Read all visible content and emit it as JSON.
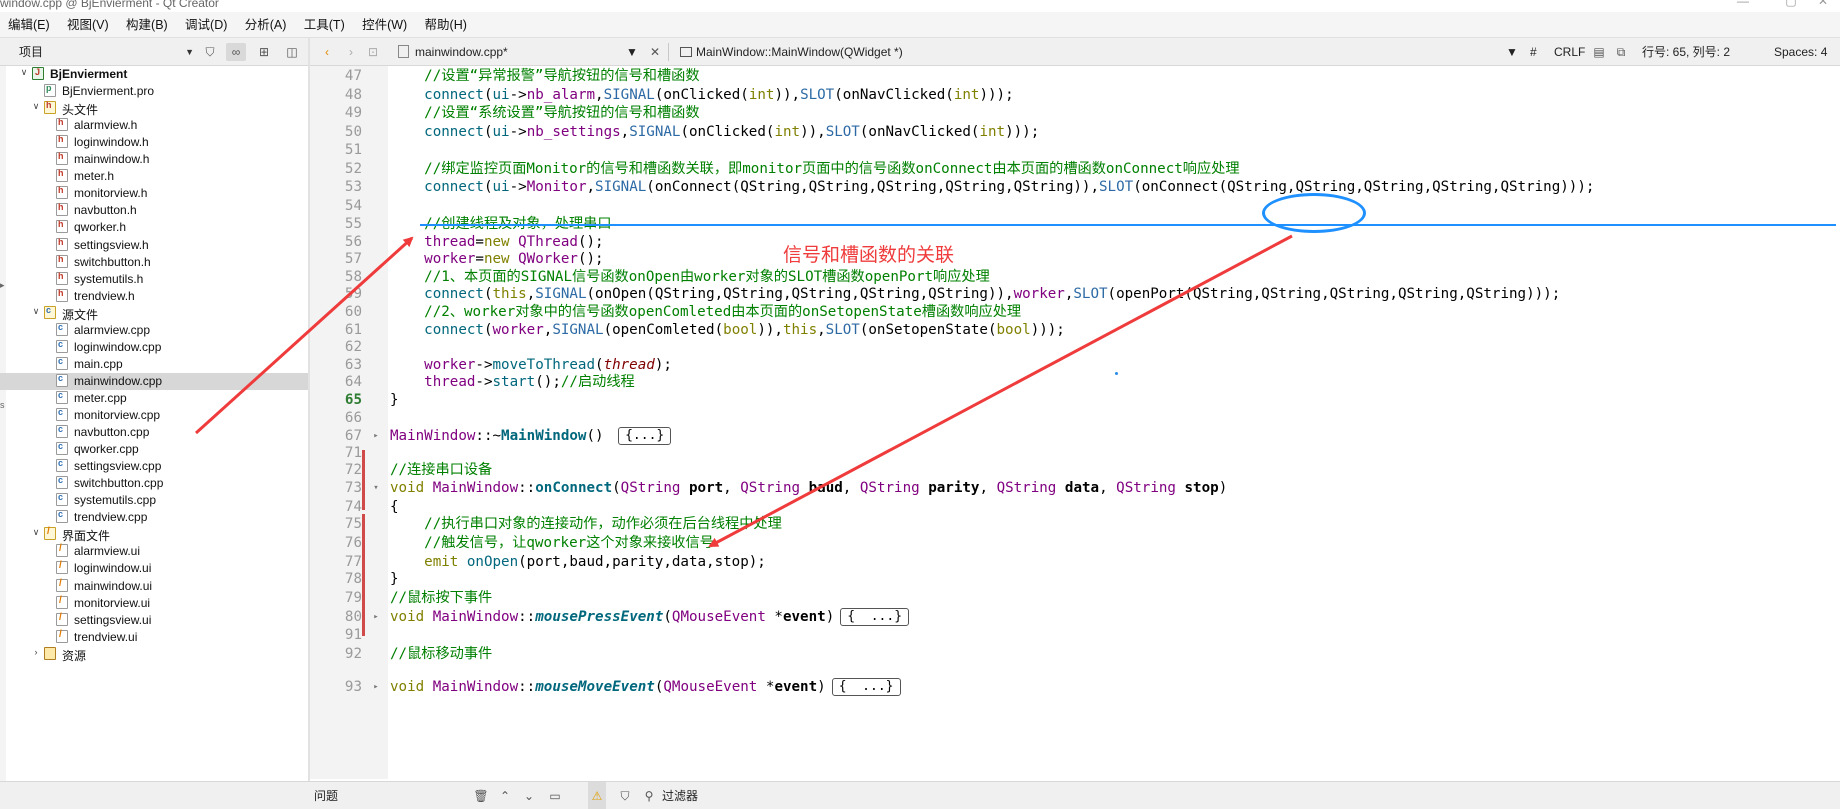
{
  "window": {
    "title": "window.cpp @ BjEnvierment - Qt Creator",
    "controls": [
      "—",
      "▢",
      "✕"
    ]
  },
  "menubar": [
    "编辑(E)",
    "视图(V)",
    "构建(B)",
    "调试(D)",
    "分析(A)",
    "工具(T)",
    "控件(W)",
    "帮助(H)"
  ],
  "left_panel": {
    "combo_label": "项目",
    "tree": [
      {
        "label": "BjEnvierment",
        "level": 0,
        "kind": "root",
        "expanded": true,
        "bold": true
      },
      {
        "label": "BjEnvierment.pro",
        "level": 1,
        "kind": "pro"
      },
      {
        "label": "头文件",
        "level": 1,
        "kind": "folder-h",
        "expanded": true
      },
      {
        "label": "alarmview.h",
        "level": 2,
        "kind": "h"
      },
      {
        "label": "loginwindow.h",
        "level": 2,
        "kind": "h"
      },
      {
        "label": "mainwindow.h",
        "level": 2,
        "kind": "h"
      },
      {
        "label": "meter.h",
        "level": 2,
        "kind": "h"
      },
      {
        "label": "monitorview.h",
        "level": 2,
        "kind": "h"
      },
      {
        "label": "navbutton.h",
        "level": 2,
        "kind": "h"
      },
      {
        "label": "qworker.h",
        "level": 2,
        "kind": "h"
      },
      {
        "label": "settingsview.h",
        "level": 2,
        "kind": "h"
      },
      {
        "label": "switchbutton.h",
        "level": 2,
        "kind": "h"
      },
      {
        "label": "systemutils.h",
        "level": 2,
        "kind": "h"
      },
      {
        "label": "trendview.h",
        "level": 2,
        "kind": "h"
      },
      {
        "label": "源文件",
        "level": 1,
        "kind": "folder-cpp",
        "expanded": true
      },
      {
        "label": "alarmview.cpp",
        "level": 2,
        "kind": "cpp"
      },
      {
        "label": "loginwindow.cpp",
        "level": 2,
        "kind": "cpp"
      },
      {
        "label": "main.cpp",
        "level": 2,
        "kind": "cpp"
      },
      {
        "label": "mainwindow.cpp",
        "level": 2,
        "kind": "cpp",
        "selected": true
      },
      {
        "label": "meter.cpp",
        "level": 2,
        "kind": "cpp"
      },
      {
        "label": "monitorview.cpp",
        "level": 2,
        "kind": "cpp"
      },
      {
        "label": "navbutton.cpp",
        "level": 2,
        "kind": "cpp"
      },
      {
        "label": "qworker.cpp",
        "level": 2,
        "kind": "cpp"
      },
      {
        "label": "settingsview.cpp",
        "level": 2,
        "kind": "cpp"
      },
      {
        "label": "switchbutton.cpp",
        "level": 2,
        "kind": "cpp"
      },
      {
        "label": "systemutils.cpp",
        "level": 2,
        "kind": "cpp"
      },
      {
        "label": "trendview.cpp",
        "level": 2,
        "kind": "cpp"
      },
      {
        "label": "界面文件",
        "level": 1,
        "kind": "folder-ui",
        "expanded": true
      },
      {
        "label": "alarmview.ui",
        "level": 2,
        "kind": "ui"
      },
      {
        "label": "loginwindow.ui",
        "level": 2,
        "kind": "ui"
      },
      {
        "label": "mainwindow.ui",
        "level": 2,
        "kind": "ui"
      },
      {
        "label": "monitorview.ui",
        "level": 2,
        "kind": "ui"
      },
      {
        "label": "settingsview.ui",
        "level": 2,
        "kind": "ui"
      },
      {
        "label": "trendview.ui",
        "level": 2,
        "kind": "ui"
      },
      {
        "label": "资源",
        "level": 1,
        "kind": "folder-res",
        "expanded": false
      }
    ]
  },
  "editor_toolbar": {
    "file_tab": "mainwindow.cpp*",
    "symbol": "MainWindow::MainWindow(QWidget *)",
    "hash": "#",
    "line_ending": "CRLF",
    "position": "行号: 65, 列号: 2",
    "spaces": "Spaces: 4"
  },
  "code_lines": [
    {
      "n": "47",
      "tokens": [
        [
          "    ",
          "pl"
        ],
        [
          "//设置“异常报警”导航按钮的信号和槽函数",
          "cmt"
        ]
      ]
    },
    {
      "n": "48",
      "tokens": [
        [
          "    ",
          "pl"
        ],
        [
          "connect",
          "fn"
        ],
        [
          "(",
          "pl"
        ],
        [
          "ui",
          "fn"
        ],
        [
          "->",
          "pl"
        ],
        [
          "nb_alarm",
          "typ"
        ],
        [
          ",",
          "pl"
        ],
        [
          "SIGNAL",
          "mac"
        ],
        [
          "(onClicked(",
          "pl"
        ],
        [
          "int",
          "kw"
        ],
        [
          ")),",
          "pl"
        ],
        [
          "SLOT",
          "mac"
        ],
        [
          "(onNavClicked(",
          "pl"
        ],
        [
          "int",
          "kw"
        ],
        [
          ")));",
          "pl"
        ]
      ]
    },
    {
      "n": "49",
      "tokens": [
        [
          "    ",
          "pl"
        ],
        [
          "//设置“系统设置”导航按钮的信号和槽函数",
          "cmt"
        ]
      ]
    },
    {
      "n": "50",
      "tokens": [
        [
          "    ",
          "pl"
        ],
        [
          "connect",
          "fn"
        ],
        [
          "(",
          "pl"
        ],
        [
          "ui",
          "fn"
        ],
        [
          "->",
          "pl"
        ],
        [
          "nb_settings",
          "typ"
        ],
        [
          ",",
          "pl"
        ],
        [
          "SIGNAL",
          "mac"
        ],
        [
          "(onClicked(",
          "pl"
        ],
        [
          "int",
          "kw"
        ],
        [
          ")),",
          "pl"
        ],
        [
          "SLOT",
          "mac"
        ],
        [
          "(onNavClicked(",
          "pl"
        ],
        [
          "int",
          "kw"
        ],
        [
          ")));",
          "pl"
        ]
      ]
    },
    {
      "n": "51",
      "tokens": []
    },
    {
      "n": "52",
      "tokens": [
        [
          "    ",
          "pl"
        ],
        [
          "//绑定监控页面Monitor的信号和槽函数关联，即monitor页面中的信号函数onConnect由本页面的槽函数onConnect响应处理",
          "cmt"
        ]
      ]
    },
    {
      "n": "53",
      "tokens": [
        [
          "    ",
          "pl"
        ],
        [
          "connect",
          "fn"
        ],
        [
          "(",
          "pl"
        ],
        [
          "ui",
          "fn"
        ],
        [
          "->",
          "pl"
        ],
        [
          "Monitor",
          "typ"
        ],
        [
          ",",
          "pl"
        ],
        [
          "SIGNAL",
          "mac"
        ],
        [
          "(onConnect(QString,QString,QString,QString,QString)),",
          "pl"
        ],
        [
          "SLOT",
          "mac"
        ],
        [
          "(onConnect(QString,QString,QString,QString,QString)));",
          "pl"
        ]
      ]
    },
    {
      "n": "54",
      "tokens": []
    },
    {
      "n": "55",
      "tokens": [
        [
          "    ",
          "pl"
        ],
        [
          "//创建线程及对象，处理串口",
          "cmt"
        ]
      ]
    },
    {
      "n": "56",
      "tokens": [
        [
          "    ",
          "pl"
        ],
        [
          "thread",
          "typ"
        ],
        [
          "=",
          "pl"
        ],
        [
          "new",
          "kw"
        ],
        [
          " ",
          "pl"
        ],
        [
          "QThread",
          "cls"
        ],
        [
          "();",
          "pl"
        ]
      ]
    },
    {
      "n": "57",
      "tokens": [
        [
          "    ",
          "pl"
        ],
        [
          "worker",
          "typ"
        ],
        [
          "=",
          "pl"
        ],
        [
          "new",
          "kw"
        ],
        [
          " ",
          "pl"
        ],
        [
          "QWorker",
          "cls"
        ],
        [
          "();",
          "pl"
        ]
      ]
    },
    {
      "n": "58",
      "tokens": [
        [
          "    ",
          "pl"
        ],
        [
          "//1、本页面的SIGNAL信号函数onOpen由worker对象的SLOT槽函数openPort响应处理",
          "cmt"
        ]
      ]
    },
    {
      "n": "59",
      "tokens": [
        [
          "    ",
          "pl"
        ],
        [
          "connect",
          "fn"
        ],
        [
          "(",
          "pl"
        ],
        [
          "this",
          "kw"
        ],
        [
          ",",
          "pl"
        ],
        [
          "SIGNAL",
          "mac"
        ],
        [
          "(onOpen(QString,QString,QString,QString,QString)),",
          "pl"
        ],
        [
          "worker",
          "typ"
        ],
        [
          ",",
          "pl"
        ],
        [
          "SLOT",
          "mac"
        ],
        [
          "(openPort(QString,QString,QString,QString,QString)));",
          "pl"
        ]
      ]
    },
    {
      "n": "60",
      "tokens": [
        [
          "    ",
          "pl"
        ],
        [
          "//2、worker对象中的信号函数openComleted由本页面的onSetopenState槽函数响应处理",
          "cmt"
        ]
      ]
    },
    {
      "n": "61",
      "tokens": [
        [
          "    ",
          "pl"
        ],
        [
          "connect",
          "fn"
        ],
        [
          "(",
          "pl"
        ],
        [
          "worker",
          "typ"
        ],
        [
          ",",
          "pl"
        ],
        [
          "SIGNAL",
          "mac"
        ],
        [
          "(openComleted(",
          "pl"
        ],
        [
          "bool",
          "kw"
        ],
        [
          ")),",
          "pl"
        ],
        [
          "this",
          "kw"
        ],
        [
          ",",
          "pl"
        ],
        [
          "SLOT",
          "mac"
        ],
        [
          "(onSetopenState(",
          "pl"
        ],
        [
          "bool",
          "kw"
        ],
        [
          ")));",
          "pl"
        ]
      ]
    },
    {
      "n": "62",
      "tokens": []
    },
    {
      "n": "63",
      "tokens": [
        [
          "    ",
          "pl"
        ],
        [
          "worker",
          "typ"
        ],
        [
          "->",
          "pl"
        ],
        [
          "moveToThread",
          "fn"
        ],
        [
          "(",
          "pl"
        ],
        [
          "thread",
          "it"
        ],
        [
          ");",
          "pl"
        ]
      ]
    },
    {
      "n": "64",
      "tokens": [
        [
          "    ",
          "pl"
        ],
        [
          "thread",
          "typ"
        ],
        [
          "->",
          "pl"
        ],
        [
          "start",
          "fn"
        ],
        [
          "();",
          "pl"
        ],
        [
          "//启动线程",
          "cmt"
        ]
      ]
    },
    {
      "n": "65",
      "tokens": [
        [
          "}",
          "pl"
        ]
      ],
      "current": true
    },
    {
      "n": "66",
      "tokens": []
    },
    {
      "n": "67",
      "tokens": [
        [
          "MainWindow",
          "cls"
        ],
        [
          "::~",
          "pl"
        ],
        [
          "MainWindow",
          "fnb"
        ],
        [
          "() ",
          "pl"
        ]
      ],
      "fold": "▸",
      "collapsed": "{...}"
    },
    {
      "n": "71",
      "tokens": []
    },
    {
      "n": "72",
      "tokens": [
        [
          "//连接串口设备",
          "cmt"
        ]
      ]
    },
    {
      "n": "73",
      "tokens": [
        [
          "void",
          "kw"
        ],
        [
          " ",
          "pl"
        ],
        [
          "MainWindow",
          "cls"
        ],
        [
          "::",
          "pl"
        ],
        [
          "onConnect",
          "fnb"
        ],
        [
          "(",
          "pl"
        ],
        [
          "QString",
          "cls"
        ],
        [
          " ",
          "pl"
        ],
        [
          "port",
          "par"
        ],
        [
          ", ",
          "pl"
        ],
        [
          "QString",
          "cls"
        ],
        [
          " ",
          "pl"
        ],
        [
          "baud",
          "par"
        ],
        [
          ", ",
          "pl"
        ],
        [
          "QString",
          "cls"
        ],
        [
          " ",
          "pl"
        ],
        [
          "parity",
          "par"
        ],
        [
          ", ",
          "pl"
        ],
        [
          "QString",
          "cls"
        ],
        [
          " ",
          "pl"
        ],
        [
          "data",
          "par"
        ],
        [
          ", ",
          "pl"
        ],
        [
          "QString",
          "cls"
        ],
        [
          " ",
          "pl"
        ],
        [
          "stop",
          "par"
        ],
        [
          ")",
          "pl"
        ]
      ],
      "fold": "▾"
    },
    {
      "n": "74",
      "tokens": [
        [
          "{",
          "pl"
        ]
      ]
    },
    {
      "n": "75",
      "tokens": [
        [
          "    ",
          "pl"
        ],
        [
          "//执行串口对象的连接动作，动作必须在后台线程中处理",
          "cmt"
        ]
      ]
    },
    {
      "n": "76",
      "tokens": [
        [
          "    ",
          "pl"
        ],
        [
          "//触发信号，让qworker这个对象来接收信号",
          "cmt"
        ]
      ]
    },
    {
      "n": "77",
      "tokens": [
        [
          "    ",
          "pl"
        ],
        [
          "emit",
          "kw"
        ],
        [
          " ",
          "pl"
        ],
        [
          "onOpen",
          "fn"
        ],
        [
          "(port,baud,parity,data,stop);",
          "pl"
        ]
      ]
    },
    {
      "n": "78",
      "tokens": [
        [
          "}",
          "pl"
        ]
      ]
    },
    {
      "n": "79",
      "tokens": [
        [
          "//鼠标按下事件",
          "cmt"
        ]
      ]
    },
    {
      "n": "80",
      "tokens": [
        [
          "void",
          "kw"
        ],
        [
          " ",
          "pl"
        ],
        [
          "MainWindow",
          "cls"
        ],
        [
          "::",
          "pl"
        ],
        [
          "mousePressEvent",
          "fnbi"
        ],
        [
          "(",
          "pl"
        ],
        [
          "QMouseEvent",
          "cls"
        ],
        [
          " *",
          "pl"
        ],
        [
          "event",
          "par"
        ],
        [
          ")",
          "pl"
        ]
      ],
      "fold": "▸",
      "collapsed": "{  ...}"
    },
    {
      "n": "91",
      "tokens": []
    },
    {
      "n": "92",
      "tokens": [
        [
          "//鼠标移动事件",
          "cmt"
        ]
      ]
    },
    {
      "n": "93",
      "tokens": [
        [
          "void",
          "kw"
        ],
        [
          " ",
          "pl"
        ],
        [
          "MainWindow",
          "cls"
        ],
        [
          "::",
          "pl"
        ],
        [
          "mouseMoveEvent",
          "fnbi"
        ],
        [
          "(",
          "pl"
        ],
        [
          "QMouseEvent",
          "cls"
        ],
        [
          " *",
          "pl"
        ],
        [
          "event",
          "par"
        ],
        [
          ")",
          "pl"
        ]
      ],
      "fold": "▸",
      "collapsed": "{  ...}"
    }
  ],
  "annotation": {
    "label": "信号和槽函数的关联",
    "arrow_color": "#ef3b3b",
    "highlight_color": "#1e90ff"
  },
  "bottom_bar": {
    "issues_label": "问题",
    "filter_label": "过滤器"
  }
}
